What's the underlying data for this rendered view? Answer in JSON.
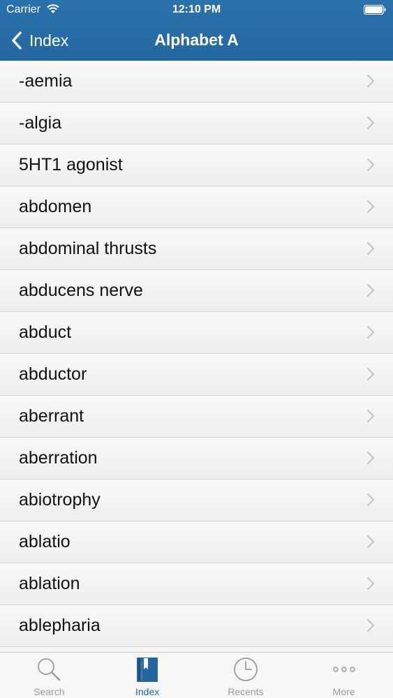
{
  "status": {
    "carrier": "Carrier",
    "time": "12:10 PM"
  },
  "nav": {
    "back_label": "Index",
    "title": "Alphabet A"
  },
  "list": {
    "items": [
      {
        "label": "-aemia"
      },
      {
        "label": "-algia"
      },
      {
        "label": "5HT1 agonist"
      },
      {
        "label": "abdomen"
      },
      {
        "label": "abdominal thrusts"
      },
      {
        "label": "abducens nerve"
      },
      {
        "label": "abduct"
      },
      {
        "label": "abductor"
      },
      {
        "label": "aberrant"
      },
      {
        "label": "aberration"
      },
      {
        "label": "abiotrophy"
      },
      {
        "label": "ablatio"
      },
      {
        "label": "ablation"
      },
      {
        "label": "ablepharia"
      }
    ]
  },
  "tabbar": {
    "tabs": [
      {
        "label": "Search",
        "icon": "magnifier-icon",
        "active": false
      },
      {
        "label": "Index",
        "icon": "book-icon",
        "active": true
      },
      {
        "label": "Recents",
        "icon": "clock-icon",
        "active": false
      },
      {
        "label": "More",
        "icon": "more-dots-icon",
        "active": false
      }
    ]
  },
  "colors": {
    "nav_bg": "#2467a0",
    "active_tab": "#2467a0",
    "inactive_tab": "#9a9aa0"
  }
}
